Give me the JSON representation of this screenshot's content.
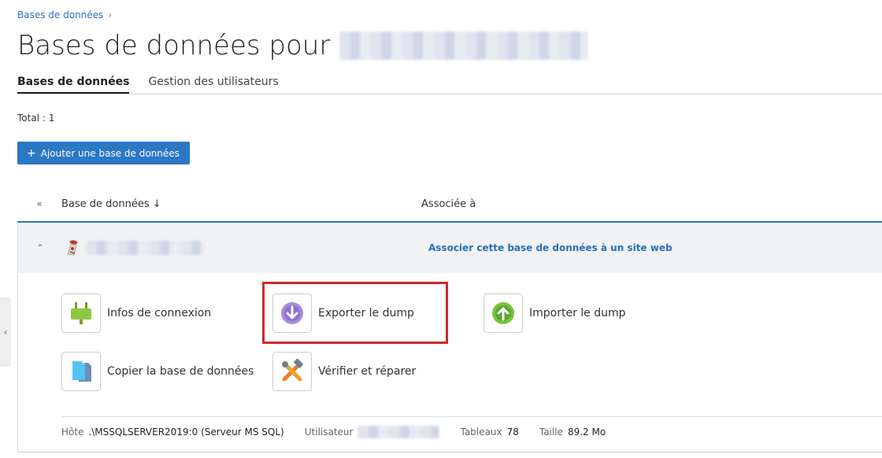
{
  "breadcrumb": {
    "label": "Bases de données",
    "separator": "›"
  },
  "title": {
    "prefix": "Bases de données pour"
  },
  "tabs": [
    {
      "label": "Bases de données",
      "active": true
    },
    {
      "label": "Gestion des utilisateurs",
      "active": false
    }
  ],
  "total": "Total : 1",
  "add_button": {
    "icon": "+",
    "label": "Ajouter une base de données"
  },
  "table": {
    "collapse_all_icon": "«",
    "col_database": "Base de données ↓",
    "col_associated": "Associée à",
    "toggle_icon": "⌃"
  },
  "row": {
    "assoc_link": "Associer cette base de données à un site web"
  },
  "actions": {
    "connection_info": "Infos de connexion",
    "export_dump": "Exporter le dump",
    "import_dump": "Importer le dump",
    "copy_db": "Copier la base de données",
    "check_repair": "Vérifier et réparer"
  },
  "info": {
    "host_label": "Hôte",
    "host_value": ".\\MSSQLSERVER2019:0 (Serveur MS SQL)",
    "user_label": "Utilisateur",
    "tables_label": "Tableaux",
    "tables_value": "78",
    "size_label": "Taille",
    "size_value": "89.2 Mo"
  },
  "side_handle_icon": "‹",
  "colors": {
    "accent": "#2b78c5",
    "highlight": "#cc2a2a",
    "link": "#2a6fbf"
  }
}
